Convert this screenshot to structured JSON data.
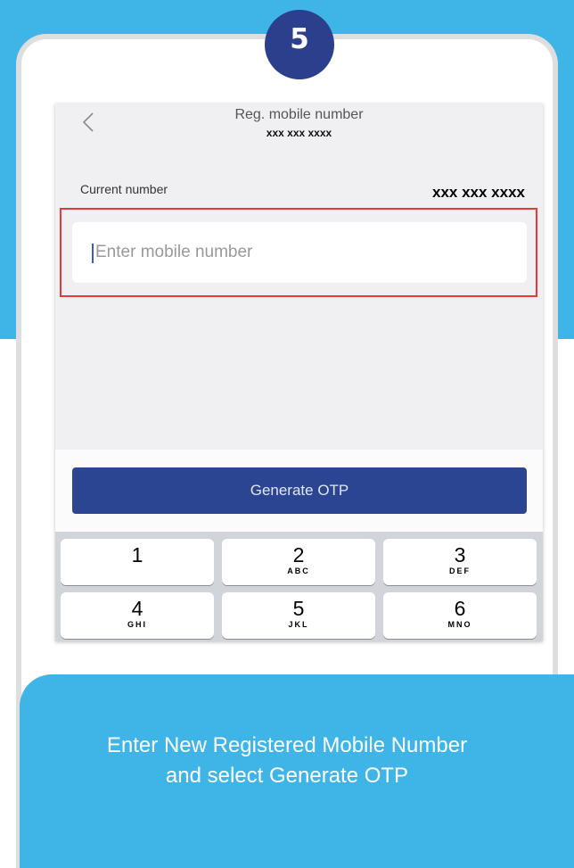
{
  "step": {
    "number": "5"
  },
  "header": {
    "title": "Reg. mobile number",
    "subtitle": "xxx xxx xxxx"
  },
  "current": {
    "label": "Current number",
    "value": "xxx xxx xxxx"
  },
  "input": {
    "placeholder": "Enter mobile number"
  },
  "button": {
    "label": "Generate OTP"
  },
  "keypad": {
    "keys": [
      {
        "num": "1",
        "letters": ""
      },
      {
        "num": "2",
        "letters": "ABC"
      },
      {
        "num": "3",
        "letters": "DEF"
      },
      {
        "num": "4",
        "letters": "GHI"
      },
      {
        "num": "5",
        "letters": "JKL"
      },
      {
        "num": "6",
        "letters": "MNO"
      }
    ]
  },
  "caption": {
    "line1": "Enter New Registered Mobile Number",
    "line2": "and select Generate OTP"
  },
  "colors": {
    "accent": "#3fb4e7",
    "badge": "#2c3f8c",
    "button": "#2b4592",
    "highlight": "#e53a3a"
  }
}
